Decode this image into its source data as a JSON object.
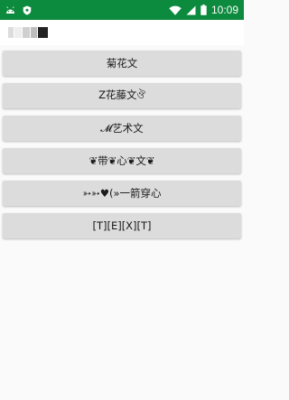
{
  "status_bar": {
    "time": "10:09",
    "background": "#0c8a3d",
    "left_icons": [
      "android-icon",
      "shield-icon"
    ],
    "right_icons": [
      "wifi-icon",
      "signal-icon",
      "battery-icon"
    ]
  },
  "input": {
    "value": "",
    "underline_color": "#2e8b3a"
  },
  "buttons": [
    {
      "label": "菊花文"
    },
    {
      "label": "Z花藤文ঔ"
    },
    {
      "label": "𝓜艺术文"
    },
    {
      "label": "❦带❦心❦文❦"
    },
    {
      "label": "➳➳♥(»一箭穿心"
    },
    {
      "label": "[T][E][X][T]"
    }
  ]
}
